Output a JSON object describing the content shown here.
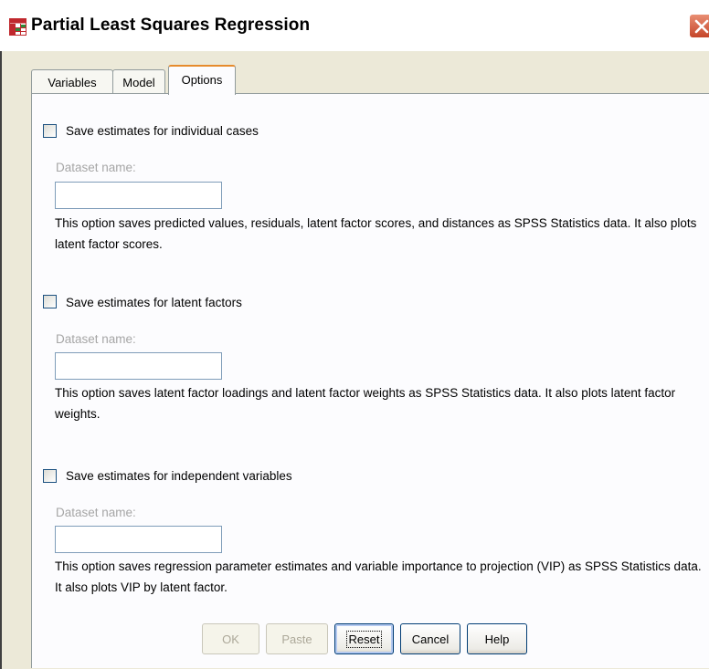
{
  "window": {
    "title": "Partial Least Squares Regression",
    "colors": {
      "accent_tab": "#e68b2c",
      "close": "#c5462a",
      "disabled_text": "#a6a6a6"
    }
  },
  "tabs": [
    {
      "label": "Variables",
      "active": false
    },
    {
      "label": "Model",
      "active": false
    },
    {
      "label": "Options",
      "active": true
    }
  ],
  "sections": [
    {
      "checkbox_label": "Save estimates for individual cases",
      "checked": false,
      "dataset_label": "Dataset name:",
      "dataset_value": "",
      "description": "This option saves predicted values, residuals, latent factor scores, and distances as SPSS Statistics data. It also plots latent factor scores."
    },
    {
      "checkbox_label": "Save estimates for latent factors",
      "checked": false,
      "dataset_label": "Dataset name:",
      "dataset_value": "",
      "description": "This option saves latent factor loadings and latent factor weights as SPSS  Statistics data. It also plots latent factor weights."
    },
    {
      "checkbox_label": "Save estimates for independent variables",
      "checked": false,
      "dataset_label": "Dataset name:",
      "dataset_value": "",
      "description": "This option saves regression parameter estimates and variable importance to projection (VIP) as SPSS  Statistics data. It also plots VIP by latent factor."
    }
  ],
  "buttons": {
    "ok": "OK",
    "paste": "Paste",
    "reset": "Reset",
    "cancel": "Cancel",
    "help": "Help"
  },
  "icons": {
    "app": "spss-table-icon",
    "close": "close-icon"
  }
}
